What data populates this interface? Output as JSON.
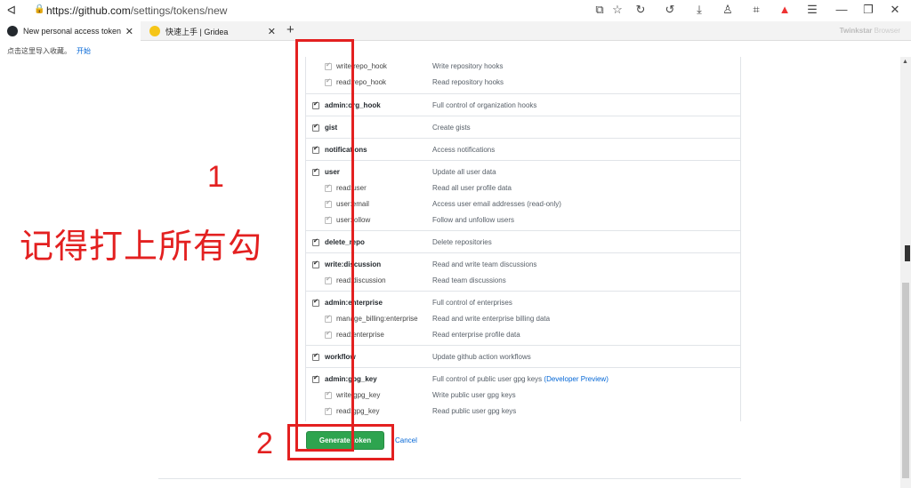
{
  "browser": {
    "url_prefix": "https://github.com",
    "url_path": "/settings/tokens/new",
    "tabs": [
      {
        "label": "New personal access token",
        "icon": "github-icon"
      },
      {
        "label": "快速上手 | Gridea",
        "icon": "gridea-icon"
      }
    ],
    "brand": "Twinkstar",
    "brand_sub": "Browser",
    "bookmark_hint": "点击这里导入收藏。",
    "bookmark_link": "开始"
  },
  "scopes": [
    {
      "main": null,
      "subs": [
        {
          "name": "write:repo_hook",
          "desc": "Write repository hooks"
        },
        {
          "name": "read:repo_hook",
          "desc": "Read repository hooks"
        }
      ]
    },
    {
      "main": {
        "name": "admin:org_hook",
        "desc": "Full control of organization hooks"
      },
      "subs": []
    },
    {
      "main": {
        "name": "gist",
        "desc": "Create gists"
      },
      "subs": []
    },
    {
      "main": {
        "name": "notifications",
        "desc": "Access notifications"
      },
      "subs": []
    },
    {
      "main": {
        "name": "user",
        "desc": "Update all user data"
      },
      "subs": [
        {
          "name": "read:user",
          "desc": "Read all user profile data"
        },
        {
          "name": "user:email",
          "desc": "Access user email addresses (read-only)"
        },
        {
          "name": "user:follow",
          "desc": "Follow and unfollow users"
        }
      ]
    },
    {
      "main": {
        "name": "delete_repo",
        "desc": "Delete repositories"
      },
      "subs": []
    },
    {
      "main": {
        "name": "write:discussion",
        "desc": "Read and write team discussions"
      },
      "subs": [
        {
          "name": "read:discussion",
          "desc": "Read team discussions"
        }
      ]
    },
    {
      "main": {
        "name": "admin:enterprise",
        "desc": "Full control of enterprises"
      },
      "subs": [
        {
          "name": "manage_billing:enterprise",
          "desc": "Read and write enterprise billing data"
        },
        {
          "name": "read:enterprise",
          "desc": "Read enterprise profile data"
        }
      ]
    },
    {
      "main": {
        "name": "workflow",
        "desc": "Update github action workflows"
      },
      "subs": []
    },
    {
      "main": {
        "name": "admin:gpg_key",
        "desc": "Full control of public user gpg keys",
        "desc_link": "(Developer Preview)"
      },
      "subs": [
        {
          "name": "write:gpg_key",
          "desc": "Write public user gpg keys"
        },
        {
          "name": "read:gpg_key",
          "desc": "Read public user gpg keys"
        }
      ]
    }
  ],
  "actions": {
    "generate": "Generate token",
    "cancel": "Cancel"
  },
  "annotations": {
    "num1": "1",
    "num2": "2",
    "note": "记得打上所有勾",
    "color": "#e32020"
  }
}
